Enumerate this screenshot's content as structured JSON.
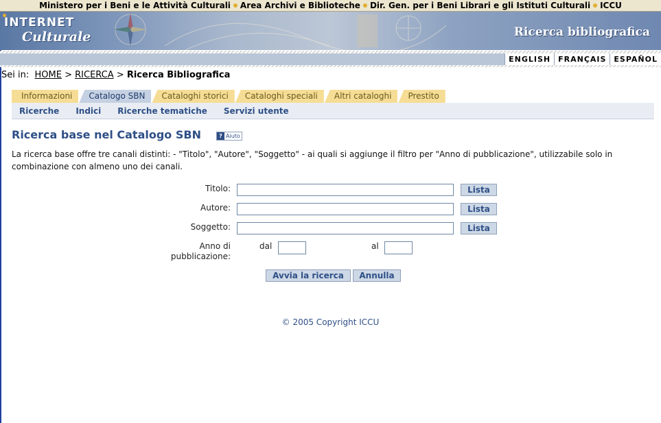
{
  "topbar": {
    "items": [
      "Ministero per i Beni e le Attività Culturali",
      "Area Archivi e Biblioteche",
      "Dir. Gen. per i Beni Librari e gli Istituti Culturali",
      "ICCU"
    ]
  },
  "banner": {
    "logo_line1": "INTERNET",
    "logo_line2": "Culturale",
    "subtitle": "Ricerca bibliografica"
  },
  "languages": [
    "ENGLISH",
    "FRANÇAIS",
    "ESPAÑOL"
  ],
  "breadcrumb": {
    "prefix": "Sei in:",
    "home": "HOME",
    "sep1": ">",
    "ricerca": "RICERCA",
    "sep2": ">",
    "current": "Ricerca Bibliografica"
  },
  "tabs": [
    {
      "label": "Informazioni",
      "active": false
    },
    {
      "label": "Catalogo SBN",
      "active": true
    },
    {
      "label": "Cataloghi storici",
      "active": false
    },
    {
      "label": "Cataloghi speciali",
      "active": false
    },
    {
      "label": "Altri cataloghi",
      "active": false
    },
    {
      "label": "Prestito",
      "active": false
    }
  ],
  "subnav": [
    "Ricerche",
    "Indici",
    "Ricerche tematiche",
    "Servizi utente"
  ],
  "page": {
    "title": "Ricerca base nel Catalogo SBN",
    "help_label": "Aiuto",
    "help_icon": "?",
    "intro": "La ricerca base offre tre canali distinti: - \"Titolo\", \"Autore\", \"Soggetto\" - ai quali si aggiunge il filtro per \"Anno di pubblicazione\", utilizzabile solo in combinazione con almeno uno dei canali."
  },
  "form": {
    "titolo_label": "Titolo:",
    "autore_label": "Autore:",
    "soggetto_label": "Soggetto:",
    "lista_label": "Lista",
    "anno_label_1": "Anno di",
    "anno_label_2": "pubblicazione:",
    "dal_label": "dal",
    "al_label": "al",
    "submit_label": "Avvia la ricerca",
    "reset_label": "Annulla",
    "titolo_value": "",
    "autore_value": "",
    "soggetto_value": "",
    "dal_value": "",
    "al_value": ""
  },
  "footer": {
    "copyright": "© 2005 Copyright ICCU"
  },
  "colors": {
    "accent": "#2e4f86",
    "tab_inactive": "#f6dd95",
    "tab_active": "#c5d1e2"
  }
}
